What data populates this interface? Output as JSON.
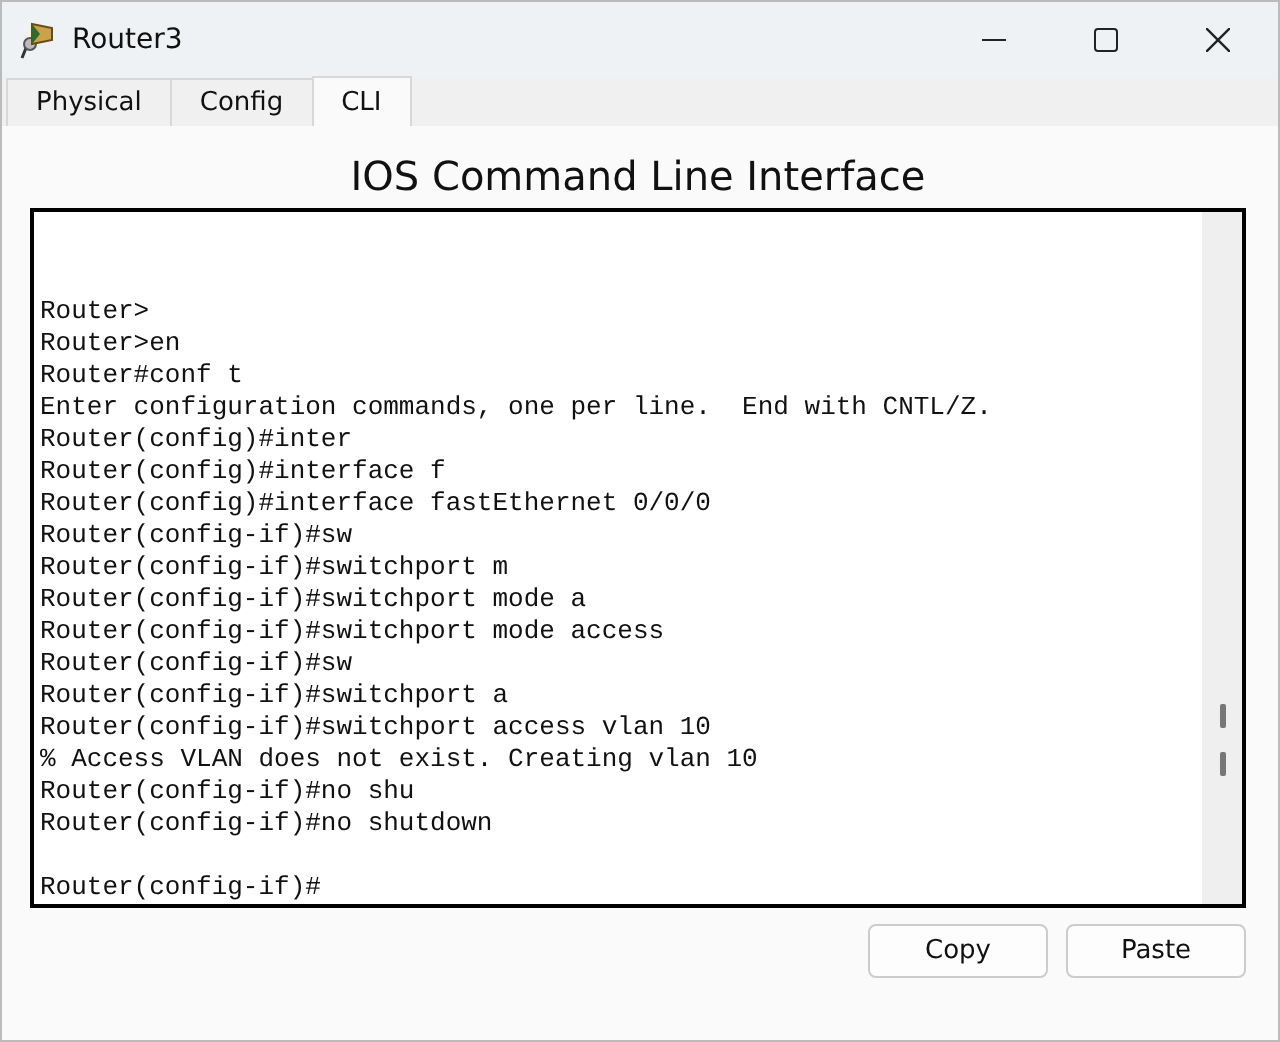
{
  "window": {
    "title": "Router3"
  },
  "tabs": [
    {
      "label": "Physical",
      "selected": false
    },
    {
      "label": "Config",
      "selected": false
    },
    {
      "label": "CLI",
      "selected": true
    }
  ],
  "heading": "IOS Command Line Interface",
  "terminal": {
    "blocks": [
      [
        "Router>",
        "Router>en",
        "Router#conf t",
        "Enter configuration commands, one per line.  End with CNTL/Z.",
        "Router(config)#inter",
        "Router(config)#interface f",
        "Router(config)#interface fastEthernet 0/0/0",
        "Router(config-if)#sw",
        "Router(config-if)#switchport m",
        "Router(config-if)#switchport mode a",
        "Router(config-if)#switchport mode access",
        "Router(config-if)#sw",
        "Router(config-if)#switchport a",
        "Router(config-if)#switchport access vlan 10",
        "% Access VLAN does not exist. Creating vlan 10",
        "Router(config-if)#no shu",
        "Router(config-if)#no shutdown"
      ],
      [
        "Router(config-if)#"
      ]
    ]
  },
  "buttons": [
    "Copy",
    "Paste"
  ]
}
